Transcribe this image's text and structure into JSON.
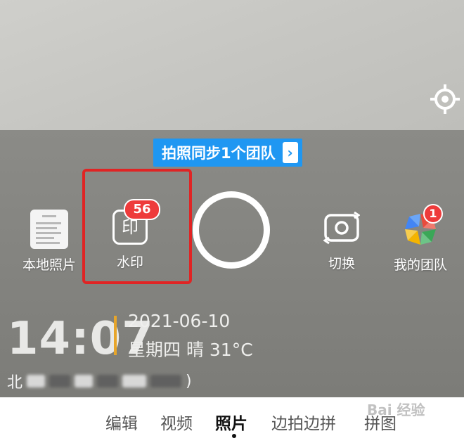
{
  "camera": {
    "sync_banner": {
      "text": "拍照同步1个团队",
      "arrow": "›"
    }
  },
  "tools": {
    "local_photos": {
      "label": "本地照片",
      "icon": "album-thumbnail"
    },
    "watermark": {
      "label": "水印",
      "icon_char": "印",
      "badge": "56"
    },
    "switch": {
      "label": "切换",
      "icon": "camera-switch-icon"
    },
    "my_team": {
      "label": "我的团队",
      "badge": "1",
      "icon": "team-pinwheel-icon"
    }
  },
  "watermark_stamp": {
    "time": "14:07",
    "date": "2021-06-10",
    "weather": "星期四 晴 31°C",
    "location_prefix": "北",
    "location_suffix": ")"
  },
  "modes": [
    {
      "label": "编辑",
      "active": false
    },
    {
      "label": "视频",
      "active": false
    },
    {
      "label": "照片",
      "active": true
    },
    {
      "label": "边拍边拼",
      "active": false
    },
    {
      "label": "拼图",
      "active": false
    }
  ],
  "site_watermark": "Bai 经验",
  "colors": {
    "accent_blue": "#1f97f2",
    "badge_red": "#ee3b3b",
    "highlight_red": "#e02424",
    "divider_gold": "#e7a52a"
  }
}
